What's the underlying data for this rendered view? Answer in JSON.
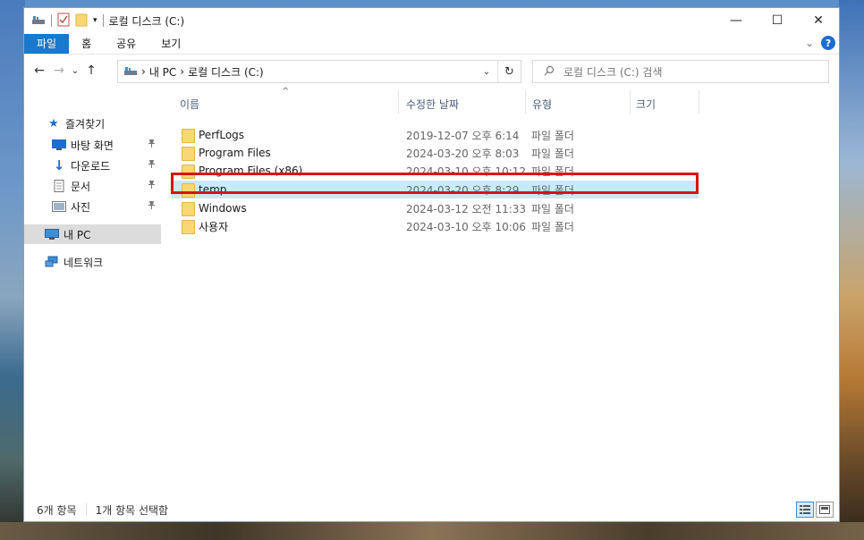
{
  "window": {
    "title": "로컬 디스크 (C:)",
    "buttons": {
      "minimize": "—",
      "maximize": "☐",
      "close": "✕"
    }
  },
  "ribbon": {
    "tabs": [
      "파일",
      "홈",
      "공유",
      "보기"
    ],
    "expand": "⌄",
    "help": "?"
  },
  "address": {
    "back": "←",
    "forward": "→",
    "recent": "⌄",
    "up": "↑",
    "crumbs": [
      "내 PC",
      "로컬 디스크 (C:)"
    ],
    "separator": "›",
    "dropdown": "⌄",
    "refresh": "↻"
  },
  "search": {
    "placeholder": "로컬 디스크 (C:) 검색"
  },
  "navpane": {
    "quick_access": "즐겨찾기",
    "items": [
      {
        "label": "바탕 화면",
        "icon": "desktop-icon",
        "pinned": true
      },
      {
        "label": "다운로드",
        "icon": "download-icon",
        "pinned": true
      },
      {
        "label": "문서",
        "icon": "document-icon",
        "pinned": true
      },
      {
        "label": "사진",
        "icon": "picture-icon",
        "pinned": true
      }
    ],
    "this_pc": "내 PC",
    "network": "네트워크",
    "pin_glyph": "📌"
  },
  "columns": {
    "name": "이름",
    "date": "수정한 날짜",
    "type": "유형",
    "size": "크기",
    "sort_caret": "^"
  },
  "files": [
    {
      "name": "PerfLogs",
      "date": "2019-12-07 오후 6:14",
      "type": "파일 폴더"
    },
    {
      "name": "Program Files",
      "date": "2024-03-20 오후 8:03",
      "type": "파일 폴더"
    },
    {
      "name": "Program Files (x86)",
      "date": "2024-03-10 오후 10:12",
      "type": "파일 폴더"
    },
    {
      "name": "temp",
      "date": "2024-03-20 오후 8:29",
      "type": "파일 폴더",
      "selected": true
    },
    {
      "name": "Windows",
      "date": "2024-03-12 오전 11:33",
      "type": "파일 폴더"
    },
    {
      "name": "사용자",
      "date": "2024-03-10 오후 10:06",
      "type": "파일 폴더"
    }
  ],
  "status": {
    "count": "6개 항목",
    "selection": "1개 항목 선택함"
  },
  "colors": {
    "file_tab": "#1979ca",
    "selection": "#cce8ff",
    "highlight_border": "#e01010",
    "folder": "#f8d775"
  }
}
